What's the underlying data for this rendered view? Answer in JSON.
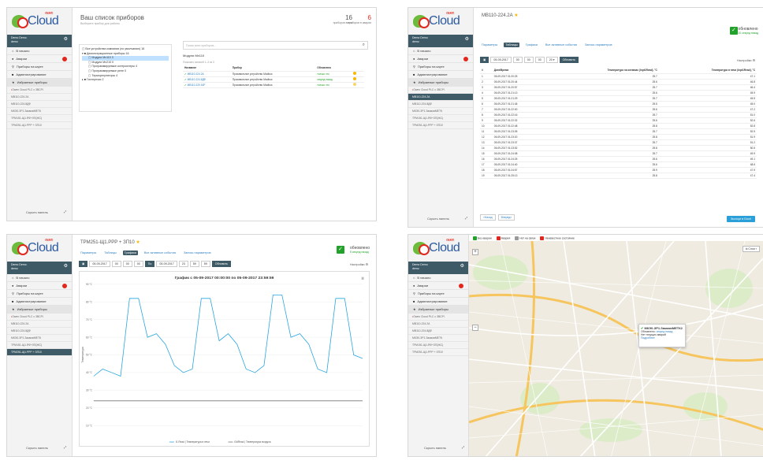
{
  "brand": {
    "logo_text": "Cloud",
    "logo_sup": "owen"
  },
  "user": {
    "name": "Demo Demo",
    "role": "demo"
  },
  "sidebar": {
    "items": [
      {
        "label": "В начало"
      },
      {
        "label": "Аварии"
      },
      {
        "label": "Приборы на карте"
      },
      {
        "label": "Администрирование"
      }
    ],
    "favorites_label": "Избранные приборы",
    "favorite_devices": [
      "Owen Cloud PLC с ЗВСРІ",
      "МВ110-224.2А",
      "МВ110-224.8ДФ",
      "МКЭ0-ЗР1.ЗамковМЕТК",
      "ТРМ151-Щ1.ЯФ+ЗП(ЖС)",
      "ТРМ251-Щ1.РРР + ЗП10"
    ],
    "hide_label": "Скрыть панель"
  },
  "panel1": {
    "title": "Ваш список приборов",
    "subtitle": "Выберите прибор для работы",
    "count_devices": {
      "value": "16",
      "label": "приборов всего"
    },
    "count_alarms": {
      "value": "6",
      "label": "приборов в аварии"
    },
    "search_placeholder": "Поиск всех приборов...",
    "tree": [
      "Все устройства компании (по умолчанию) 16",
      "Демонстрационные приборы 16",
      "Модули Мх110 3",
      "Модули Мх210 0",
      "Программируемые контроллеры 4",
      "Программируемые реле 0",
      "Терморегуляторы 4",
      "Гистерезис 2"
    ],
    "module_title": "Модули Мх110",
    "module_sub": "Показано записей 1–3 из 3",
    "columns": [
      "Название",
      "Прибор",
      "Обновлено"
    ],
    "rows": [
      {
        "name": "МВ110-224.2А",
        "device": "Произвольное устройство Modbus",
        "updated": "только что"
      },
      {
        "name": "МВ110-224.8ДФ",
        "device": "Произвольное устройство Modbus",
        "updated": "секунд назад"
      },
      {
        "name": "МВ110-220.16Р",
        "device": "Произвольное устройство Modbus",
        "updated": "только что"
      }
    ]
  },
  "panel2": {
    "title": "МВ110-224.2А",
    "status": "обновлено",
    "status_time": "10 секунд назад",
    "tabs": [
      "Параметры",
      "Таблицы",
      "Графики",
      "Все активные события",
      "Запись параметров"
    ],
    "active_tab": "Таблицы",
    "date_from": "05-09-2017",
    "time": [
      "00",
      "00",
      "00",
      "20"
    ],
    "refresh": "Обновить",
    "settings": "Настройки",
    "columns": [
      "#",
      "Дата/Время",
      "Температура на клеммах (Inpt1Read), °С",
      "Температура в печи (Inpt1Read), °С"
    ],
    "rows": [
      [
        "1",
        "05-09-2017 01:20:25",
        "25.7",
        "47.1"
      ],
      [
        "2",
        "05-09-2017 01:20:44",
        "25.6",
        "46.8"
      ],
      [
        "3",
        "05-09-2017 01:20:57",
        "25.7",
        "46.4"
      ],
      [
        "4",
        "05-09-2017 01:21:13",
        "25.6",
        "45.9"
      ],
      [
        "5",
        "05-09-2017 01:21:29",
        "25.7",
        "45.5"
      ],
      [
        "6",
        "05-09-2017 01:21:45",
        "25.5",
        "45.0"
      ],
      [
        "7",
        "05-09-2017 01:22:00",
        "25.6",
        "47.2"
      ],
      [
        "8",
        "05-09-2017 01:22:16",
        "25.7",
        "51.0"
      ],
      [
        "9",
        "05-09-2017 01:22:32",
        "25.6",
        "52.6"
      ],
      [
        "10",
        "05-09-2017 01:22:48",
        "25.8",
        "52.8"
      ],
      [
        "11",
        "05-09-2017 01:23:05",
        "25.7",
        "52.5"
      ],
      [
        "12",
        "05-09-2017 01:23:20",
        "25.8",
        "51.9"
      ],
      [
        "13",
        "05-09-2017 01:23:37",
        "25.7",
        "51.2"
      ],
      [
        "14",
        "05-09-2017 01:23:52",
        "25.8",
        "50.5"
      ],
      [
        "15",
        "05-09-2017 01:24:08",
        "25.7",
        "49.9"
      ],
      [
        "16",
        "05-09-2017 01:24:25",
        "25.6",
        "49.1"
      ],
      [
        "17",
        "05-09-2017 01:24:40",
        "25.6",
        "48.6"
      ],
      [
        "18",
        "05-09-2017 01:24:57",
        "25.9",
        "47.9"
      ],
      [
        "19",
        "05-09-2017 01:25:13",
        "25.8",
        "47.4"
      ]
    ],
    "pager": [
      "«Назад",
      "Вперед»"
    ],
    "excel": "Экспорт в Excel"
  },
  "panel3": {
    "title": "ТРМ251-Щ1.РРР + ЗП10",
    "status": "обновлено",
    "status_time": "5 секунд назад",
    "tabs": [
      "Параметры",
      "Таблицы",
      "Графики",
      "Все активные события",
      "Запись параметров"
    ],
    "active_tab": "Графики",
    "date_from": "05-09-2017",
    "date_to": "05-09-2017",
    "refresh": "Обновить",
    "settings": "Настройки",
    "chart_title": "График с 05-09-2017 00:00:00 по 05-09-2017 23:59:59",
    "ylabel": "Температура",
    "y_ticks": [
      "90 °C",
      "80 °C",
      "70 °C",
      "60 °C",
      "50 °C",
      "40 °C",
      "30 °C",
      "20 °C",
      "10 °C"
    ],
    "legend": [
      "t1 Read | Температура в печи",
      "t3dRead | Температура воздуха"
    ]
  },
  "panel4": {
    "legend": [
      "Без аварии",
      "Авария",
      "Нет на связи",
      "Неизвестное состояние"
    ],
    "popup_title": "МКЭ0-ЗР1.ЗамковМЕТК2",
    "popup_updated_label": "Обновлено",
    "popup_updated": "секунд назад",
    "popup_status": "Нет текущих аварий",
    "popup_link": "Подробнее",
    "layers": "Слои",
    "zoom_in": "+",
    "zoom_out": "−"
  },
  "chart_data": {
    "type": "line",
    "title": "График с 05-09-2017 00:00:00 по 05-09-2017 23:59:59",
    "ylabel": "Температура",
    "ylim": [
      10,
      90
    ],
    "series": [
      {
        "name": "t1 Read | Температура в печи",
        "values": [
          38,
          42,
          40,
          38,
          82,
          82,
          60,
          62,
          56,
          44,
          40,
          42,
          82,
          82,
          58,
          62,
          56,
          42,
          40,
          44,
          84,
          84,
          60,
          62,
          56,
          42,
          40,
          82,
          82,
          50,
          48
        ]
      },
      {
        "name": "t3dRead | Температура воздуха",
        "values": [
          24,
          24,
          24,
          24,
          24,
          24,
          24,
          24,
          24,
          24,
          24,
          24,
          24,
          24,
          24,
          24,
          24,
          24,
          24,
          24,
          24,
          24,
          24,
          24,
          24,
          24,
          24,
          24,
          24,
          24,
          24
        ]
      }
    ]
  }
}
